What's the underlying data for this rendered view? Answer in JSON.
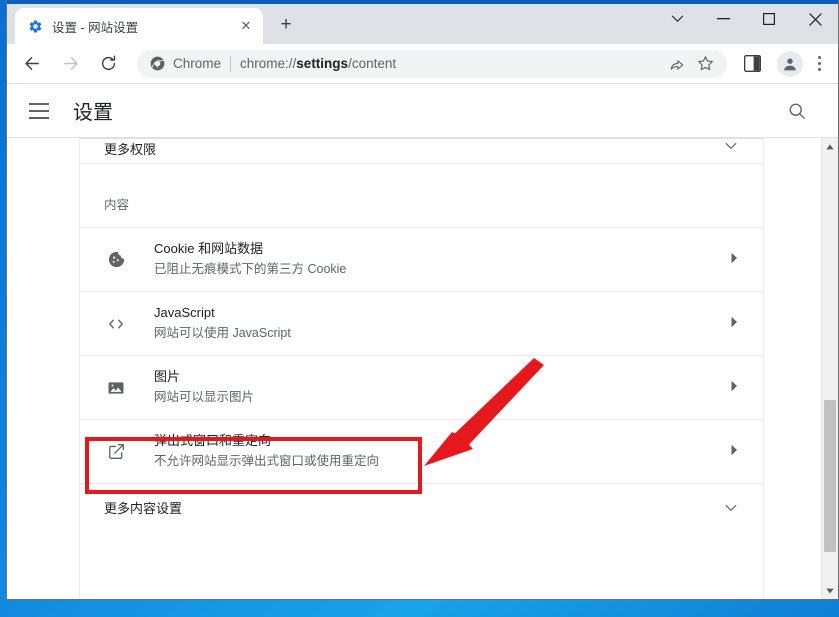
{
  "window": {
    "controls": [
      {
        "name": "tab-search-button",
        "glyph": "⌄"
      },
      {
        "name": "minimize-button",
        "glyph": "—"
      },
      {
        "name": "maximize-button",
        "glyph": "□"
      },
      {
        "name": "close-button",
        "glyph": "✕"
      }
    ]
  },
  "tabstrip": {
    "tab": {
      "title": "设置 - 网站设置",
      "favicon": "gear-icon",
      "close_glyph": "✕"
    },
    "new_tab_glyph": "+"
  },
  "toolbar": {
    "back_glyph": "←",
    "forward_glyph": "→",
    "reload_glyph": "⟳",
    "omnibox": {
      "chrome_icon": "chrome-icon",
      "label": "Chrome",
      "url_prefix": "chrome://",
      "url_bold": "settings",
      "url_suffix": "/content"
    },
    "share_icon": "share-icon",
    "bookmark_icon": "star-icon",
    "sidepanel_icon": "side-panel-icon",
    "avatar_icon": "profile-avatar-icon",
    "menu_icon": "three-dot-menu-icon"
  },
  "settings_header": {
    "menu_icon": "hamburger-icon",
    "title": "设置",
    "search_icon": "search-icon"
  },
  "content": {
    "top_collapsed_row": {
      "label": "更多权限",
      "chevron": "⌄"
    },
    "section_title": "内容",
    "rows": [
      {
        "icon": "cookie-icon",
        "title": "Cookie 和网站数据",
        "subtitle": "已阻止无痕模式下的第三方 Cookie",
        "arrow": "▸"
      },
      {
        "icon": "code-brackets-icon",
        "title": "JavaScript",
        "subtitle": "网站可以使用 JavaScript",
        "arrow": "▸"
      },
      {
        "icon": "image-icon",
        "title": "图片",
        "subtitle": "网站可以显示图片",
        "arrow": "▸"
      },
      {
        "icon": "external-link-icon",
        "title": "弹出式窗口和重定向",
        "subtitle": "不允许网站显示弹出式窗口或使用重定向",
        "arrow": "▸"
      }
    ],
    "more_row": {
      "label": "更多内容设置",
      "chevron": "⌄"
    }
  },
  "scrollbar": {
    "up_glyph": "▲",
    "down_glyph": "▼"
  },
  "annotation": {
    "highlight_color": "#e5191d",
    "arrow_color": "#e5191d",
    "target_row_index": 3
  }
}
